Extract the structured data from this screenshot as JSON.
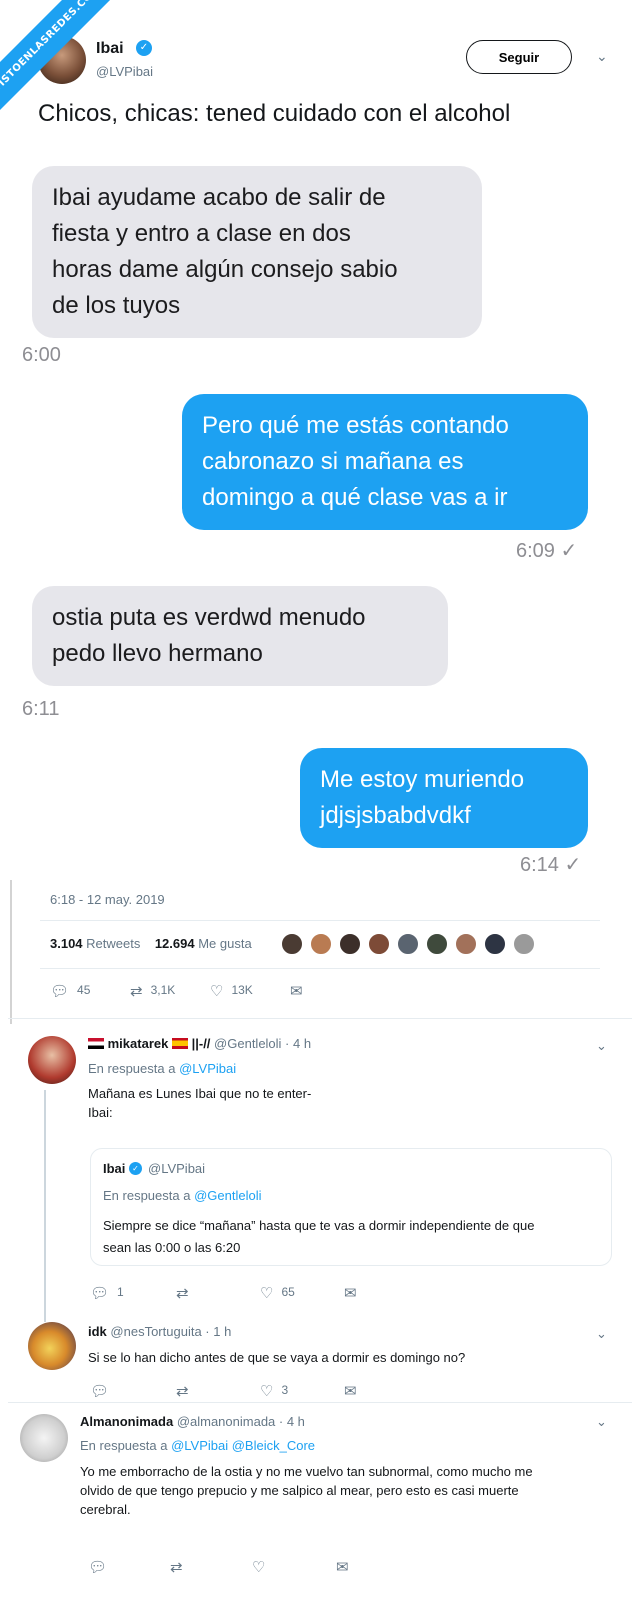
{
  "watermark": "VISTOENLASREDES.COM",
  "tweet": {
    "author_name": "Ibai",
    "author_handle": "@LVPibai",
    "follow_label": "Seguir",
    "text": "Chicos, chicas: tened cuidado con el alcohol",
    "timestamp": "6:18 - 12 may. 2019",
    "retweets": "3.104",
    "retweets_label": "Retweets",
    "likes": "12.694",
    "likes_label": "Me gusta",
    "reply_count": "45",
    "retweet_count": "3,1K",
    "like_count": "13K"
  },
  "chat": {
    "messages": [
      {
        "side": "in",
        "text_lines": [
          "Ibai ayudame acabo de salir de",
          "fiesta y entro a clase en dos",
          "horas dame algún consejo sabio",
          "de los tuyos"
        ],
        "time": "6:00"
      },
      {
        "side": "out",
        "text_lines": [
          "Pero qué me estás contando",
          "cabronazo si mañana es",
          "domingo a qué clase vas a ir"
        ],
        "time": "6:09 ✓"
      },
      {
        "side": "in",
        "text_lines": [
          "ostia puta es verdwd menudo",
          "pedo llevo hermano"
        ],
        "time": "6:11"
      },
      {
        "side": "out",
        "text_lines": [
          "Me estoy muriendo",
          "jdjsjsbabdvdkf"
        ],
        "time": "6:14 ✓"
      }
    ]
  },
  "replies": [
    {
      "name": "mikatarek",
      "name_suffix": "||-//",
      "handle": "@Gentleloli · 4 h",
      "in_reply_prefix": "En respuesta a",
      "in_reply_to": "@LVPibai",
      "text_lines": [
        "Mañana es Lunes Ibai que no te enter-",
        "Ibai:"
      ],
      "quote": {
        "name": "Ibai",
        "handle": "@LVPibai",
        "in_reply_prefix": "En respuesta a",
        "in_reply_to": "@Gentleloli",
        "text_lines": [
          "Siempre se dice “mañana” hasta que te vas a dormir independiente de que",
          "sean las 0:00 o las 6:20"
        ]
      },
      "reply_count": "1",
      "retweet_count": "",
      "like_count": "65"
    },
    {
      "name": "idk",
      "handle": "@nesTortuguita · 1 h",
      "text": "Si se lo han dicho antes de que se vaya a dormir es domingo no?",
      "reply_count": "",
      "retweet_count": "",
      "like_count": "3"
    },
    {
      "name": "Almanonimada",
      "handle": "@almanonimada · 4 h",
      "in_reply_prefix": "En respuesta a",
      "in_reply_to": "@LVPibai @Bleick_Core",
      "text_lines": [
        "Yo me emborracho de la ostia y no me vuelvo tan subnormal, como mucho me",
        "olvido de que tengo prepucio y me salpico al mear, pero esto es casi muerte",
        "cerebral."
      ],
      "reply_count": "",
      "retweet_count": "",
      "like_count": ""
    }
  ],
  "colors": {
    "accent": "#1da1f2",
    "incoming_bubble": "#e6e6eb",
    "muted": "#657786"
  }
}
